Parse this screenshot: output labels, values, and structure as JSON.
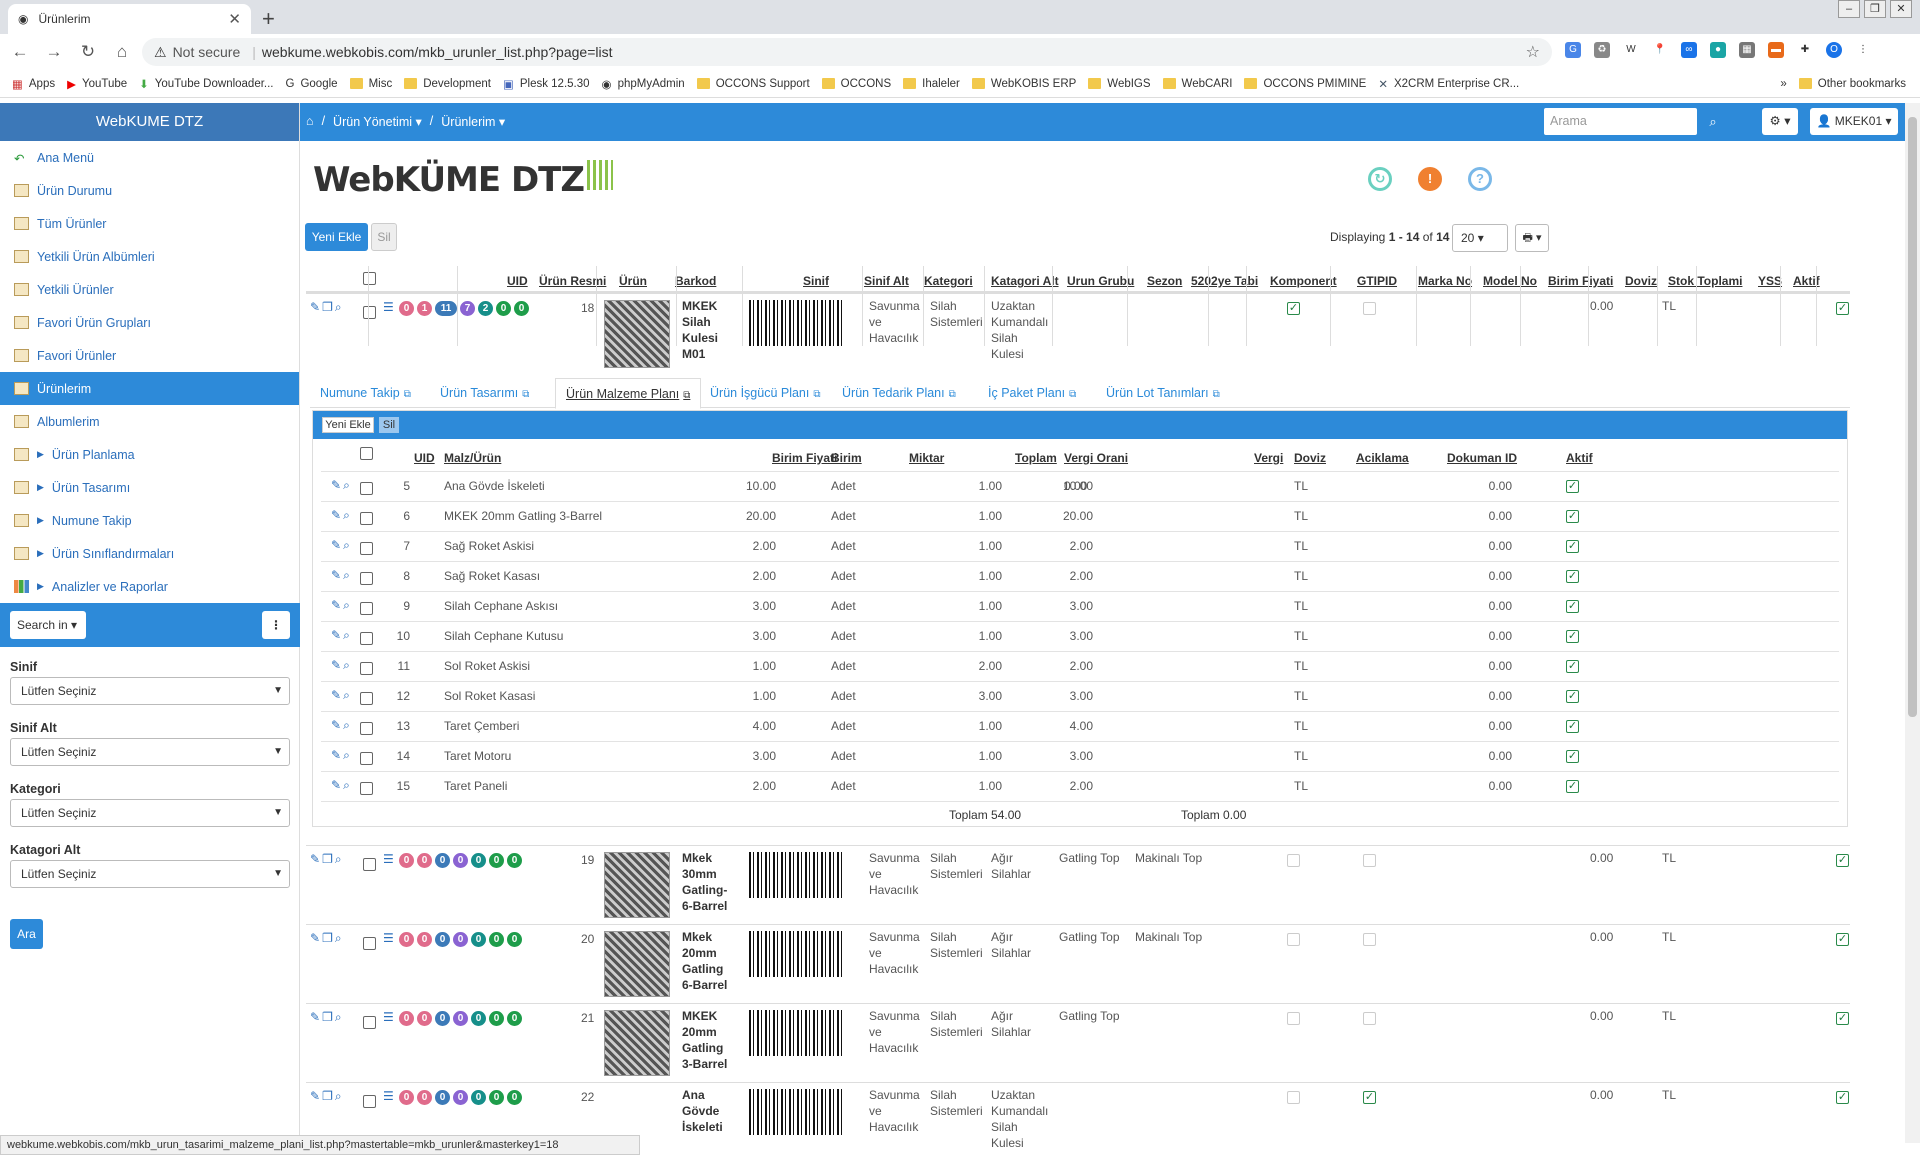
{
  "browser": {
    "tab_title": "Ürünlerim",
    "not_secure": "Not secure",
    "url": "webkume.webkobis.com/mkb_urunler_list.php?page=list",
    "bookmarks": [
      "Apps",
      "YouTube",
      "YouTube Downloader...",
      "Google",
      "Misc",
      "Development",
      "Plesk 12.5.30",
      "phpMyAdmin",
      "OCCONS Support",
      "OCCONS",
      "Ihaleler",
      "WebKOBIS ERP",
      "WebIGS",
      "WebCARI",
      "OCCONS PMIMINE",
      "X2CRM Enterprise CR..."
    ],
    "more": "»",
    "other_bookmarks": "Other bookmarks",
    "status_url": "webkume.webkobis.com/mkb_urun_tasarimi_malzeme_plani_list.php?mastertable=mkb_urunler&masterkey1=18",
    "profile_initial": "O"
  },
  "sidebar": {
    "brand": "WebKUME DTZ",
    "items": [
      {
        "label": "Ana Menü",
        "icon": "back-arrow-icon"
      },
      {
        "label": "Ürün Durumu",
        "icon": "grid-icon"
      },
      {
        "label": "Tüm Ürünler",
        "icon": "table-icon"
      },
      {
        "label": "Yetkili Ürün Albümleri",
        "icon": "table-icon"
      },
      {
        "label": "Yetkili Ürünler",
        "icon": "table-icon"
      },
      {
        "label": "Favori Ürün Grupları",
        "icon": "table-icon"
      },
      {
        "label": "Favori Ürünler",
        "icon": "table-icon"
      },
      {
        "label": "Ürünlerim",
        "icon": "table-icon",
        "active": true
      },
      {
        "label": "Albumlerim",
        "icon": "grid-icon"
      },
      {
        "label": "Ürün Planlama",
        "icon": "folder-icon",
        "expandable": true
      },
      {
        "label": "Ürün Tasarımı",
        "icon": "folder-icon",
        "expandable": true
      },
      {
        "label": "Numune Takip",
        "icon": "folder-icon",
        "expandable": true
      },
      {
        "label": "Ürün Sınıflandırmaları",
        "icon": "folder-icon",
        "expandable": true
      },
      {
        "label": "Analizler ve Raporlar",
        "icon": "chart-icon",
        "expandable": true
      }
    ],
    "search_in": "Search in",
    "filters": [
      {
        "label": "Sinif",
        "value": "Lütfen Seçiniz"
      },
      {
        "label": "Sinif Alt",
        "value": "Lütfen Seçiniz"
      },
      {
        "label": "Kategori",
        "value": "Lütfen Seçiniz"
      },
      {
        "label": "Katagori Alt",
        "value": "Lütfen Seçiniz"
      }
    ],
    "search_button": "Ara"
  },
  "topnav": {
    "breadcrumbs": [
      "Ürün Yönetimi",
      "Ürünlerim"
    ],
    "search_placeholder": "Arama",
    "user": "MKEK01"
  },
  "logo_text": "WebKÜME DTZ",
  "toolbar": {
    "new_label": "Yeni Ekle",
    "delete_label": "Sil",
    "displaying_prefix": "Displaying",
    "range": "1 - 14",
    "of": "of",
    "total": "14",
    "per_page": "20"
  },
  "columns": [
    "UID",
    "Ürün Resmi",
    "Ürün",
    "Barkod",
    "Sinif",
    "Sinif Alt",
    "Kategori",
    "Katagori Alt",
    "Urun Grubu",
    "Sezon",
    "5202ye Tabi",
    "Komponent",
    "GTIPID",
    "Marka No",
    "Model No",
    "Birim Fiyati",
    "Doviz",
    "Stok Toplami",
    "YSS",
    "Aktif"
  ],
  "pill_colors": [
    "#e06b8b",
    "#e06b8b",
    "#3c7ab8",
    "#8a63d2",
    "#168f8a",
    "#1e9d4a",
    "#1e9d4a"
  ],
  "rows": [
    {
      "uid": "18",
      "pills": [
        "0",
        "1",
        "11",
        "7",
        "2",
        "0",
        "0"
      ],
      "name": [
        "MKEK",
        "Silah",
        "Kulesi",
        "M01"
      ],
      "sinif": [
        "Savunma",
        "ve",
        "Havacılık"
      ],
      "sinif_alt": [
        "Silah",
        "Sistemleri"
      ],
      "kategori": [
        "Uzaktan",
        "Kumandalı",
        "Silah",
        "Kulesi"
      ],
      "katagori_alt": "",
      "urun_grubu": "",
      "tabi": true,
      "komponent": false,
      "fiyat": "0.00",
      "doviz": "TL",
      "aktif": true
    },
    {
      "uid": "19",
      "pills": [
        "0",
        "0",
        "0",
        "0",
        "0",
        "0",
        "0"
      ],
      "name": [
        "Mkek",
        "30mm",
        "Gatling-",
        "6-Barrel"
      ],
      "sinif": [
        "Savunma",
        "ve",
        "Havacılık"
      ],
      "sinif_alt": [
        "Silah",
        "Sistemleri"
      ],
      "kategori": [
        "Ağır",
        "Silahlar"
      ],
      "katagori_alt": "Gatling Top",
      "urun_grubu": "Makinalı Top",
      "tabi": false,
      "komponent": false,
      "fiyat": "0.00",
      "doviz": "TL",
      "aktif": true
    },
    {
      "uid": "20",
      "pills": [
        "0",
        "0",
        "0",
        "0",
        "0",
        "0",
        "0"
      ],
      "name": [
        "Mkek",
        "20mm",
        "Gatling",
        "6-Barrel"
      ],
      "sinif": [
        "Savunma",
        "ve",
        "Havacılık"
      ],
      "sinif_alt": [
        "Silah",
        "Sistemleri"
      ],
      "kategori": [
        "Ağır",
        "Silahlar"
      ],
      "katagori_alt": "Gatling Top",
      "urun_grubu": "Makinalı Top",
      "tabi": false,
      "komponent": false,
      "fiyat": "0.00",
      "doviz": "TL",
      "aktif": true
    },
    {
      "uid": "21",
      "pills": [
        "0",
        "0",
        "0",
        "0",
        "0",
        "0",
        "0"
      ],
      "name": [
        "MKEK",
        "20mm",
        "Gatling",
        "3-Barrel"
      ],
      "sinif": [
        "Savunma",
        "ve",
        "Havacılık"
      ],
      "sinif_alt": [
        "Silah",
        "Sistemleri"
      ],
      "kategori": [
        "Ağır",
        "Silahlar"
      ],
      "katagori_alt": "Gatling Top",
      "urun_grubu": "",
      "tabi": false,
      "komponent": false,
      "fiyat": "0.00",
      "doviz": "TL",
      "aktif": true
    },
    {
      "uid": "22",
      "pills": [
        "0",
        "0",
        "0",
        "0",
        "0",
        "0",
        "0"
      ],
      "name": [
        "Ana",
        "Gövde",
        "İskeleti"
      ],
      "sinif": [
        "Savunma",
        "ve",
        "Havacılık"
      ],
      "sinif_alt": [
        "Silah",
        "Sistemleri"
      ],
      "kategori": [
        "Uzaktan",
        "Kumandalı",
        "Silah",
        "Kulesi"
      ],
      "katagori_alt": "",
      "urun_grubu": "",
      "tabi": false,
      "komponent": true,
      "fiyat": "0.00",
      "doviz": "TL",
      "aktif": true
    }
  ],
  "subtabs": [
    "Numune Takip",
    "Ürün Tasarımı",
    "Ürün Malzeme Planı",
    "Ürün İşgücü Planı",
    "Ürün Tedarik Planı",
    "İç Paket Planı",
    "Ürün Lot Tanımları"
  ],
  "sub": {
    "new_label": "Yeni Ekle",
    "delete_label": "Sil",
    "columns": [
      "UID",
      "Malz/Ürün",
      "Birim Fiyati",
      "Birim",
      "Miktar",
      "Toplam",
      "Vergi Orani",
      "Vergi",
      "Doviz",
      "Aciklama",
      "Dokuman ID",
      "Aktif"
    ],
    "rows": [
      {
        "uid": "5",
        "name": "Ana Gövde İskeleti",
        "fiyat": "10.00",
        "birim": "Adet",
        "miktar": "1.00",
        "toplam": "10.00",
        "oran": "0.00",
        "vergi": "0.00",
        "doviz": "TL"
      },
      {
        "uid": "6",
        "name": "MKEK 20mm Gatling 3-Barrel",
        "fiyat": "20.00",
        "birim": "Adet",
        "miktar": "1.00",
        "toplam": "20.00",
        "oran": "",
        "vergi": "0.00",
        "doviz": "TL"
      },
      {
        "uid": "7",
        "name": "Sağ Roket Askisi",
        "fiyat": "2.00",
        "birim": "Adet",
        "miktar": "1.00",
        "toplam": "2.00",
        "oran": "",
        "vergi": "0.00",
        "doviz": "TL"
      },
      {
        "uid": "8",
        "name": "Sağ Roket Kasası",
        "fiyat": "2.00",
        "birim": "Adet",
        "miktar": "1.00",
        "toplam": "2.00",
        "oran": "",
        "vergi": "0.00",
        "doviz": "TL"
      },
      {
        "uid": "9",
        "name": "Silah Cephane Askısı",
        "fiyat": "3.00",
        "birim": "Adet",
        "miktar": "1.00",
        "toplam": "3.00",
        "oran": "",
        "vergi": "0.00",
        "doviz": "TL"
      },
      {
        "uid": "10",
        "name": "Silah Cephane Kutusu",
        "fiyat": "3.00",
        "birim": "Adet",
        "miktar": "1.00",
        "toplam": "3.00",
        "oran": "",
        "vergi": "0.00",
        "doviz": "TL"
      },
      {
        "uid": "11",
        "name": "Sol Roket Askisi",
        "fiyat": "1.00",
        "birim": "Adet",
        "miktar": "2.00",
        "toplam": "2.00",
        "oran": "",
        "vergi": "0.00",
        "doviz": "TL"
      },
      {
        "uid": "12",
        "name": "Sol Roket Kasasi",
        "fiyat": "1.00",
        "birim": "Adet",
        "miktar": "3.00",
        "toplam": "3.00",
        "oran": "",
        "vergi": "0.00",
        "doviz": "TL"
      },
      {
        "uid": "13",
        "name": "Taret Çemberi",
        "fiyat": "4.00",
        "birim": "Adet",
        "miktar": "1.00",
        "toplam": "4.00",
        "oran": "",
        "vergi": "0.00",
        "doviz": "TL"
      },
      {
        "uid": "14",
        "name": "Taret Motoru",
        "fiyat": "3.00",
        "birim": "Adet",
        "miktar": "1.00",
        "toplam": "3.00",
        "oran": "",
        "vergi": "0.00",
        "doviz": "TL"
      },
      {
        "uid": "15",
        "name": "Taret Paneli",
        "fiyat": "2.00",
        "birim": "Adet",
        "miktar": "1.00",
        "toplam": "2.00",
        "oran": "",
        "vergi": "0.00",
        "doviz": "TL"
      }
    ],
    "sum_toplam": "Toplam 54.00",
    "sum_vergi": "Toplam 0.00"
  }
}
